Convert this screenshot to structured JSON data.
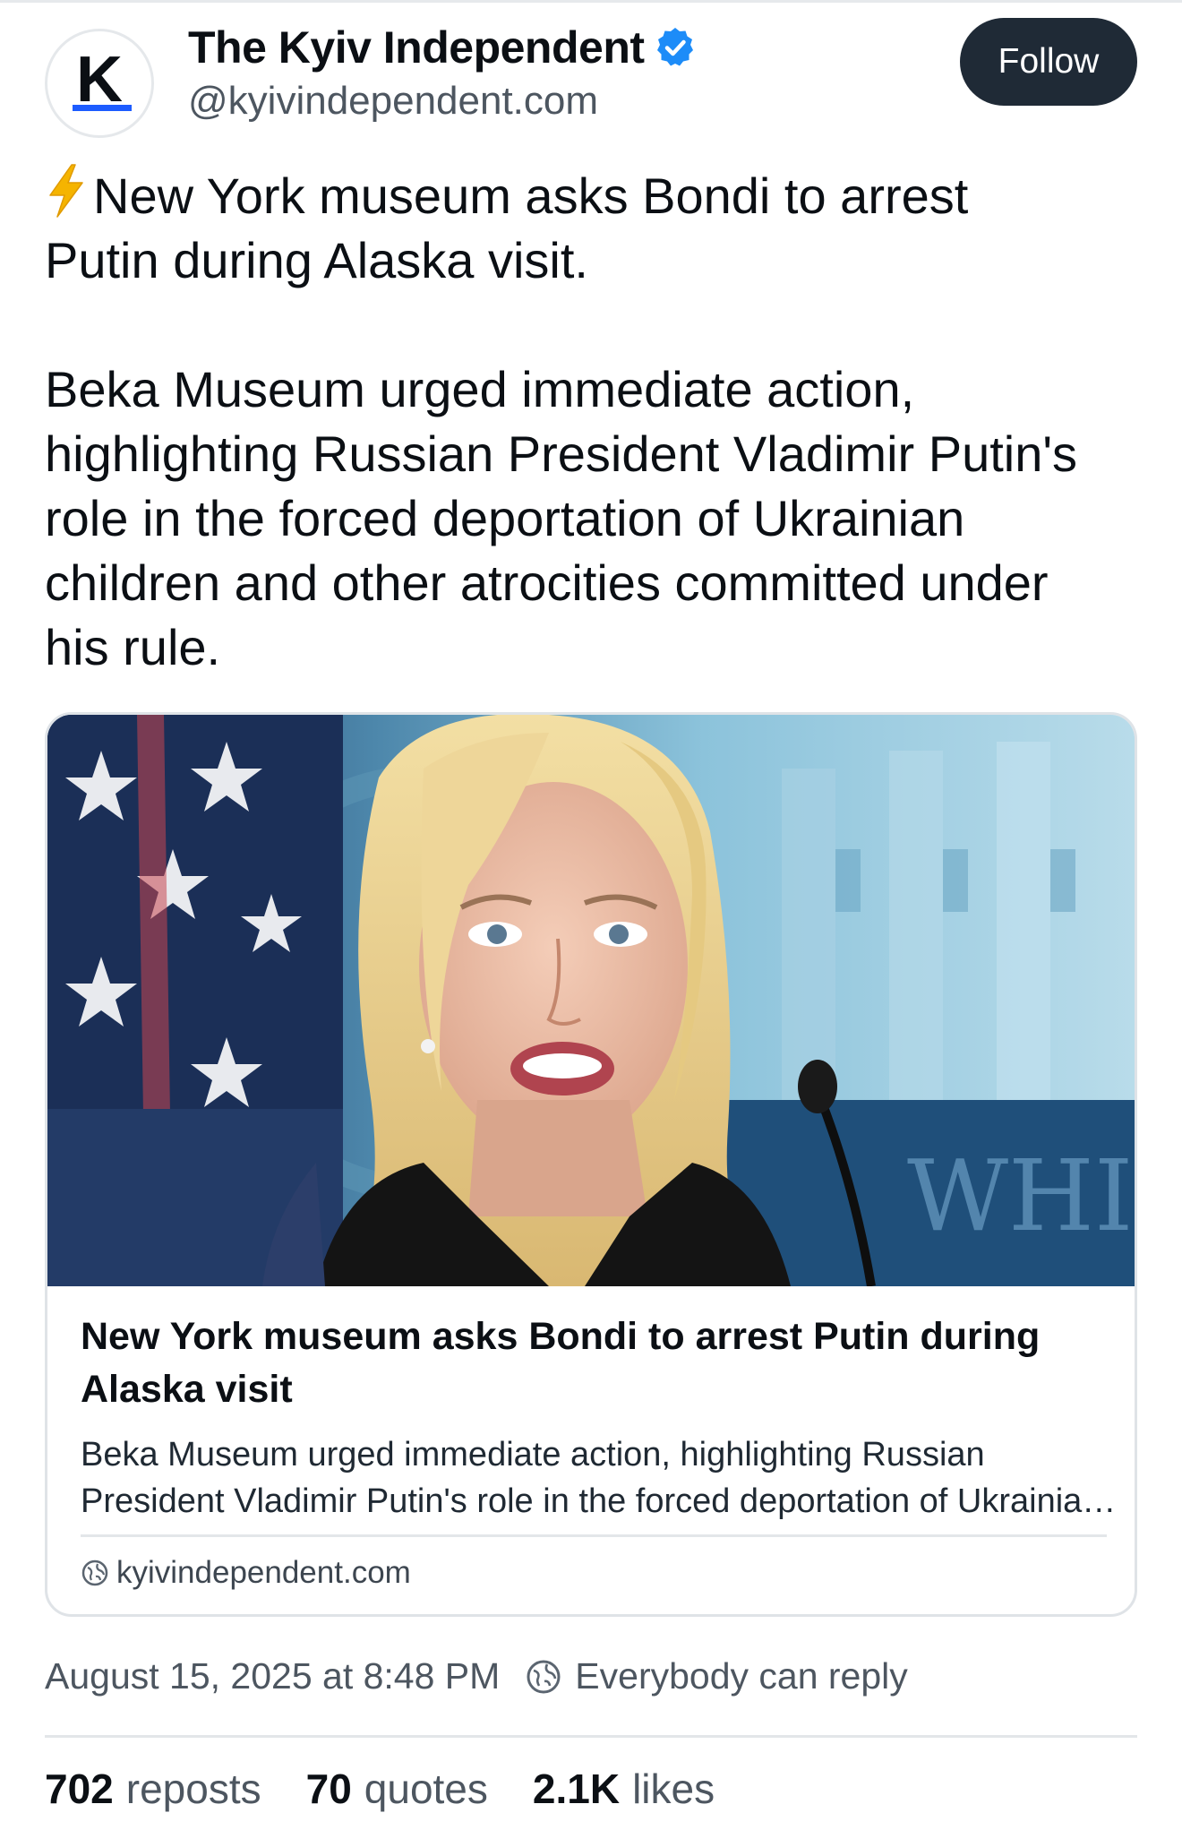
{
  "account": {
    "avatar_letter": "K",
    "display_name": "The Kyiv Independent",
    "verified_icon": "verified-badge-icon",
    "handle": "@kyivindependent.com",
    "follow_label": "Follow"
  },
  "post": {
    "headline_line1": "New York museum asks Bondi to arrest",
    "headline_line2": "Putin during Alaska visit.",
    "body_lines": [
      "Beka Museum urged immediate action,",
      "highlighting Russian President Vladimir Putin's",
      "role in the forced deportation of Ukrainian",
      "children and other atrocities committed under",
      "his rule."
    ],
    "bolt_icon": "lightning-bolt-icon"
  },
  "link_card": {
    "title": "New York museum asks Bondi to arrest Putin during Alaska visit",
    "description": "Beka Museum urged immediate action, highlighting Russian President Vladimir Putin's role in the forced deportation of Ukrainian children and other atrocities committed under his rule.",
    "source": "kyivindependent.com",
    "image_watermark": "WHI"
  },
  "meta": {
    "timestamp": "August 15, 2025 at 8:48 PM",
    "reply_setting": "Everybody can reply"
  },
  "stats": {
    "reposts_count": "702",
    "reposts_label": "reposts",
    "quotes_count": "70",
    "quotes_label": "quotes",
    "likes_count": "2.1K",
    "likes_label": "likes"
  },
  "colors": {
    "follow_bg": "#1f2a36",
    "verified_blue": "#1d8cf8",
    "bolt_yellow": "#f5b400",
    "avatar_underline": "#1d5cff"
  }
}
